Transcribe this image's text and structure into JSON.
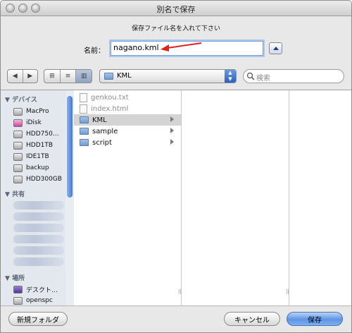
{
  "window": {
    "title": "別名で保存"
  },
  "save_prompt": "保存ファイル名を入れて下さい",
  "name_label": "名前：",
  "filename_value": "nagano.kml",
  "location_popup": "KML",
  "search_placeholder": "検索",
  "sidebar": {
    "devices_header": "デバイス",
    "devices": [
      {
        "label": "MacPro",
        "icon": "hard-drive-icon"
      },
      {
        "label": "iDisk",
        "icon": "idisk-icon"
      },
      {
        "label": "HDD750…",
        "icon": "hard-drive-icon"
      },
      {
        "label": "HDD1TB",
        "icon": "hard-drive-icon"
      },
      {
        "label": "IDE1TB",
        "icon": "hard-drive-icon"
      },
      {
        "label": "backup",
        "icon": "hard-drive-icon"
      },
      {
        "label": "HDD300GB",
        "icon": "hard-drive-icon"
      }
    ],
    "shared_header": "共有",
    "places_header": "場所",
    "places": [
      {
        "label": "デスクト…",
        "icon": "desktop-icon"
      },
      {
        "label": "openspc",
        "icon": "home-icon"
      }
    ]
  },
  "column1": [
    {
      "label": "genkou.txt",
      "kind": "file",
      "dim": true
    },
    {
      "label": "index.html",
      "kind": "file",
      "dim": true
    },
    {
      "label": "KML",
      "kind": "folder",
      "selected": true
    },
    {
      "label": "sample",
      "kind": "folder"
    },
    {
      "label": "script",
      "kind": "folder"
    }
  ],
  "buttons": {
    "new_folder": "新規フォルダ",
    "cancel": "キャンセル",
    "save": "保存"
  },
  "colors": {
    "accent": "#2c5fbf",
    "arrow": "#e3211c"
  }
}
